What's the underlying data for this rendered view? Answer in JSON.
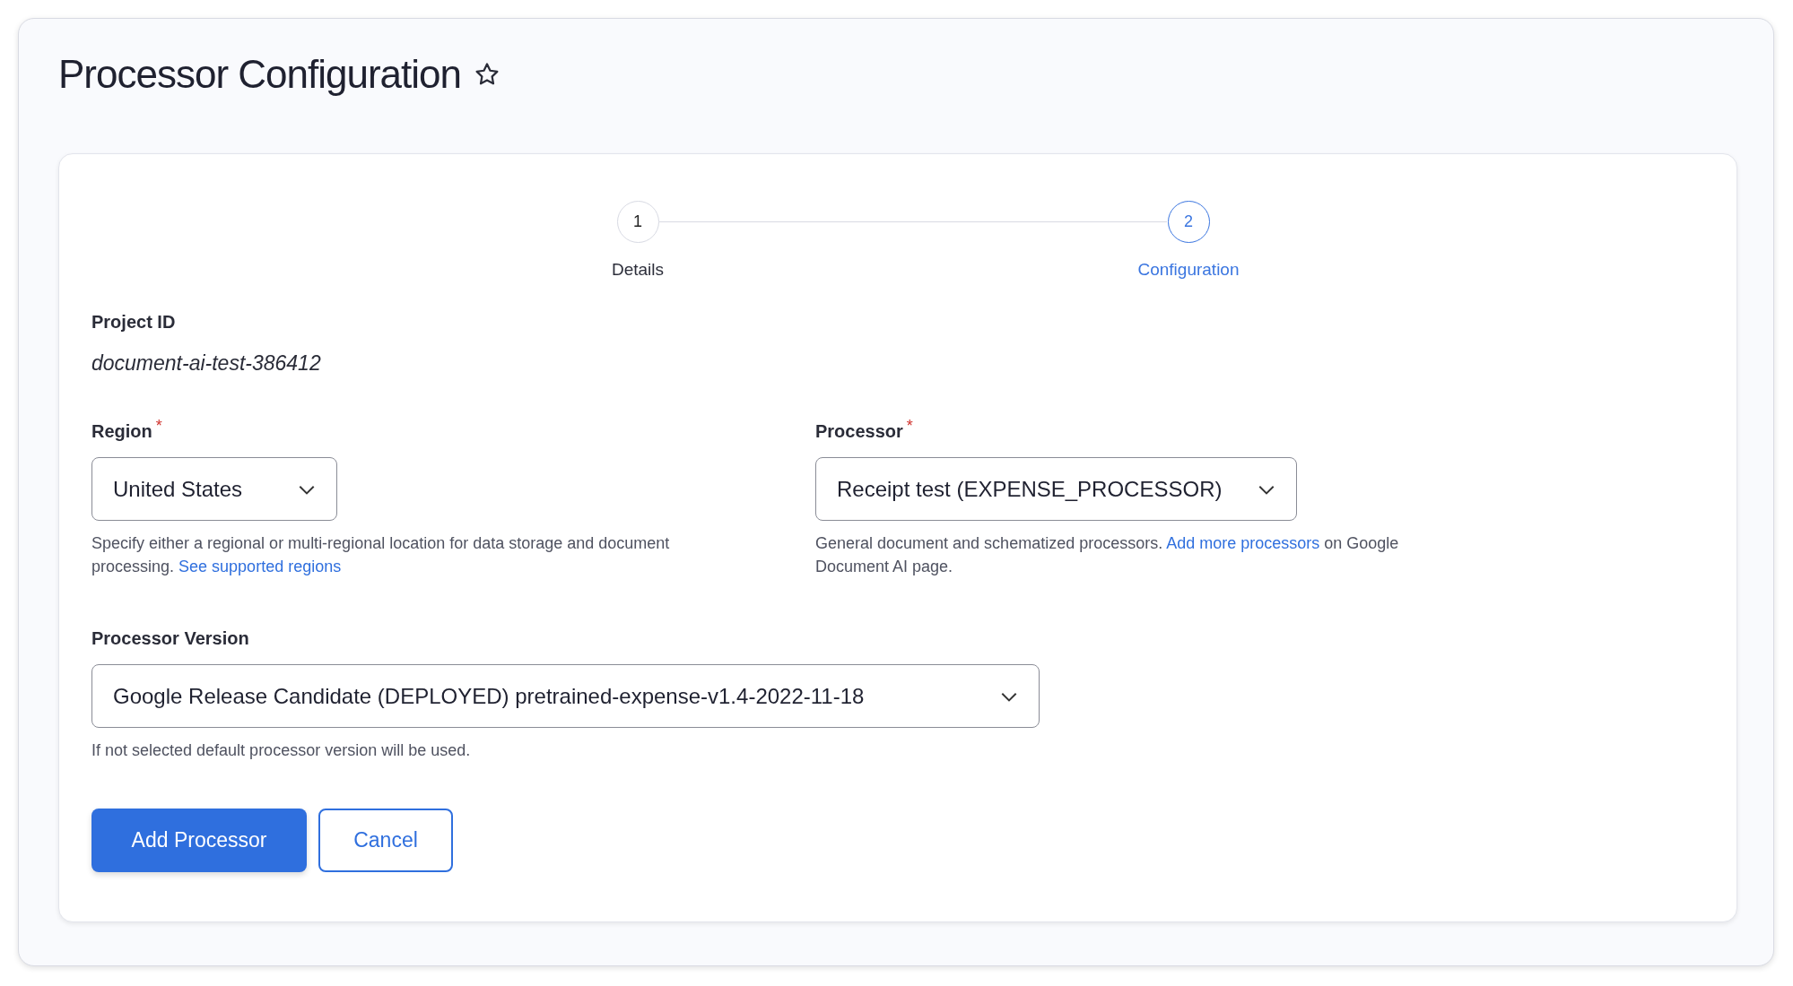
{
  "page": {
    "title": "Processor Configuration",
    "starred": false
  },
  "steps": [
    {
      "number": "1",
      "label": "Details",
      "selected": false
    },
    {
      "number": "2",
      "label": "Configuration",
      "selected": true
    }
  ],
  "project": {
    "label": "Project ID",
    "value": "document-ai-test-386412"
  },
  "fields": [
    {
      "label": "Region",
      "required_mark": "*",
      "value": "United States",
      "hint": {
        "before": "Specify either a regional or multi-regional location for data storage and document processing. ",
        "link": "See supported regions"
      }
    },
    {
      "label": "Processor",
      "required_mark": "*",
      "value": "Receipt test (EXPENSE_PROCESSOR)",
      "hint": {
        "before": "General document and schematized processors. ",
        "link": "Add more processors",
        "after": " on Google Document AI page."
      }
    },
    {
      "label": "Processor Version",
      "value": "Google Release Candidate (DEPLOYED) pretrained-expense-v1.4-2022-11-18",
      "hint": {
        "before": "If not selected default processor version will be used."
      }
    }
  ],
  "buttons": [
    {
      "label": "Add Processor",
      "kind": "primary"
    },
    {
      "label": "Cancel",
      "kind": "secondary"
    }
  ]
}
